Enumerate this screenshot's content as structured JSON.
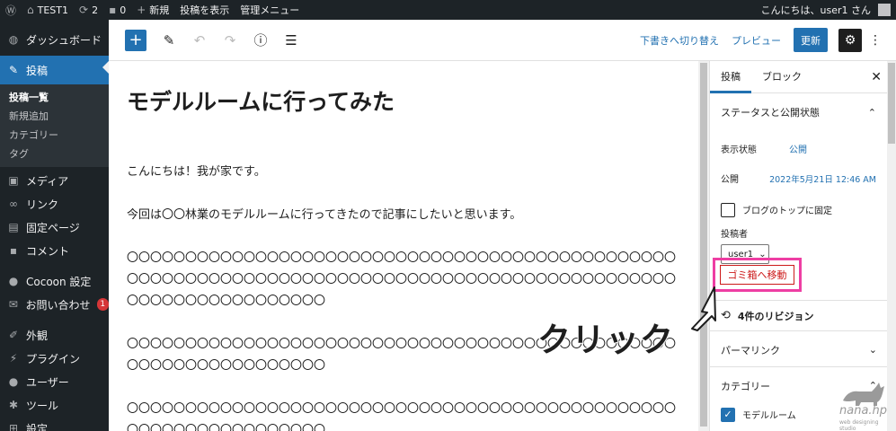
{
  "adminbar": {
    "site_name": "TEST1",
    "updates_count": "2",
    "comments_count": "0",
    "new_label": "新規",
    "view_post_label": "投稿を表示",
    "admin_menu_label": "管理メニュー",
    "greeting": "こんにちは、user1 さん"
  },
  "sidebar": {
    "dashboard": "ダッシュボード",
    "posts": "投稿",
    "submenu": [
      "投稿一覧",
      "新規追加",
      "カテゴリー",
      "タグ"
    ],
    "media": "メディア",
    "links": "リンク",
    "pages": "固定ページ",
    "comments": "コメント",
    "cocoon": "Cocoon 設定",
    "contact": "お問い合わせ",
    "contact_badge": "1",
    "appearance": "外観",
    "plugins": "プラグイン",
    "users": "ユーザー",
    "tools": "ツール",
    "settings": "設定"
  },
  "toolbar": {
    "switch_draft": "下書きへ切り替え",
    "preview": "プレビュー",
    "update": "更新"
  },
  "content": {
    "title": "モデルルームに行ってみた",
    "p1": "こんにちは！我が家です。",
    "p2": "今回は〇〇林業のモデルルームに行ってきたので記事にしたいと思います。",
    "p3": "〇〇〇〇〇〇〇〇〇〇〇〇〇〇〇〇〇〇〇〇〇〇〇〇〇〇〇〇〇〇〇〇〇〇〇〇〇〇〇〇〇〇〇〇〇〇〇〇〇〇〇〇〇〇〇〇〇〇〇〇〇〇〇〇〇〇〇〇〇〇〇〇〇〇〇〇〇〇〇〇〇〇〇〇〇〇〇〇〇〇〇〇〇〇〇〇〇〇〇〇〇〇〇〇〇〇〇〇〇〇〇",
    "p4": "〇〇〇〇〇〇〇〇〇〇〇〇〇〇〇〇〇〇〇〇〇〇〇〇〇〇〇〇〇〇〇〇〇〇〇〇〇〇〇〇〇〇〇〇〇〇〇〇〇〇〇〇〇〇〇〇〇〇〇〇〇〇〇〇",
    "p5": "〇〇〇〇〇〇〇〇〇〇〇〇〇〇〇〇〇〇〇〇〇〇〇〇〇〇〇〇〇〇〇〇〇〇〇〇〇〇〇〇〇〇〇〇〇〇〇〇〇〇〇〇〇〇〇〇〇〇〇〇〇〇〇〇"
  },
  "settings_panel": {
    "tab_post": "投稿",
    "tab_block": "ブロック",
    "status_heading": "ステータスと公開状態",
    "visibility_label": "表示状態",
    "visibility_value": "公開",
    "publish_label": "公開",
    "publish_value": "2022年5月21日 12:46 AM",
    "sticky_label": "ブログのトップに固定",
    "author_label": "投稿者",
    "author_value": "user1",
    "trash_label": "ゴミ箱へ移動",
    "revisions_label": "4件のリビジョン",
    "permalink_heading": "パーマリンク",
    "category_heading": "カテゴリー",
    "category_item": "モデルルーム"
  },
  "annotation": {
    "callout": "クリック",
    "color": "#ee3ea3"
  },
  "watermark": {
    "brand": "nana.hp",
    "sub": "web designing studio"
  }
}
